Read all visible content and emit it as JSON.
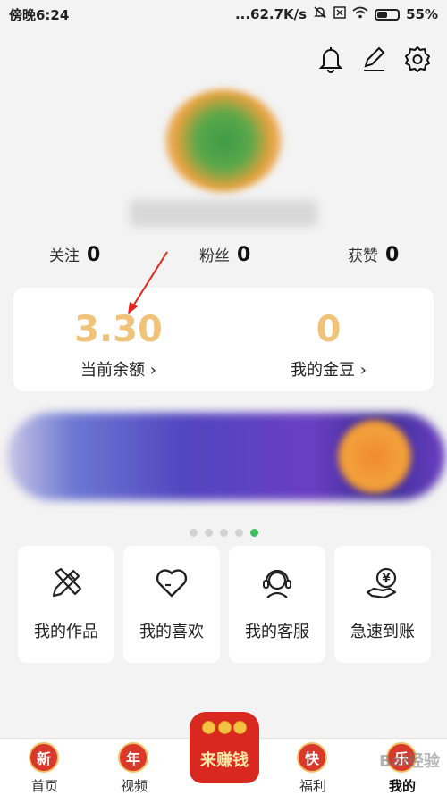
{
  "status": {
    "time": "傍晚6:24",
    "speed": "...62.7K/s",
    "battery": "55%",
    "battery_level": 0.55
  },
  "stats": [
    {
      "label": "关注",
      "value": "0"
    },
    {
      "label": "粉丝",
      "value": "0"
    },
    {
      "label": "获赞",
      "value": "0"
    }
  ],
  "wallet": {
    "balance_value": "3.30",
    "balance_label": "当前余额 ›",
    "beans_value": "0",
    "beans_label": "我的金豆 ›"
  },
  "carousel": {
    "pages": 5,
    "active": 5
  },
  "tiles": [
    {
      "label": "我的作品",
      "icon": "pencil-ruler-icon"
    },
    {
      "label": "我的喜欢",
      "icon": "heart-icon"
    },
    {
      "label": "我的客服",
      "icon": "headset-icon"
    },
    {
      "label": "急速到账",
      "icon": "yen-hand-icon"
    }
  ],
  "tabbar": {
    "home": {
      "badge": "新",
      "label": "首页"
    },
    "video": {
      "badge": "年",
      "label": "视频"
    },
    "earn": {
      "label": "来赚钱"
    },
    "welfare": {
      "badge": "快",
      "label": "福利"
    },
    "mine": {
      "badge": "乐",
      "label": "我的"
    }
  },
  "watermark": "Bai经验",
  "colors": {
    "accent_gold": "#f0c27a",
    "active_dot": "#3cbf5c",
    "tab_red": "#d8392b"
  }
}
